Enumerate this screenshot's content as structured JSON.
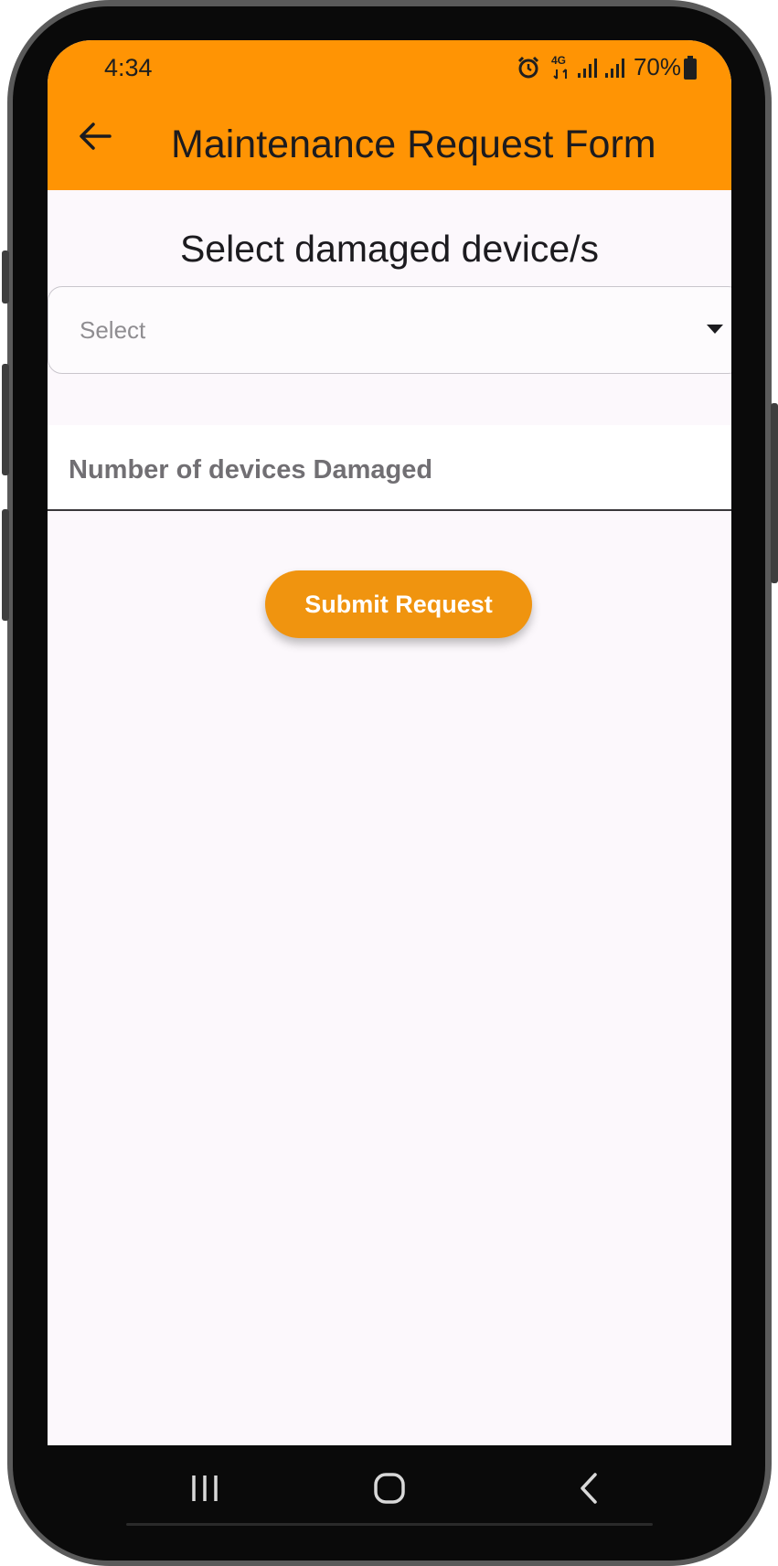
{
  "status_bar": {
    "time": "4:34",
    "network": "4G",
    "battery": "70%",
    "icons": [
      "alarm-icon",
      "network-4g-icon",
      "signal-icon",
      "signal-icon",
      "battery-icon"
    ]
  },
  "app_bar": {
    "back_icon": "arrow-left-icon",
    "title": "Maintenance Request Form"
  },
  "form": {
    "section_title": "Select damaged device/s",
    "device_select": {
      "placeholder": "Select",
      "arrow_icon": "triangle-down-icon"
    },
    "number_field": {
      "label": "Number of devices Damaged",
      "value": ""
    },
    "submit_label": "Submit Request"
  },
  "nav_bar": {
    "icons": [
      "recent-apps-icon",
      "home-icon",
      "back-icon"
    ]
  },
  "colors": {
    "app_bar": "#ff9404",
    "submit_button": "#f0940f",
    "background": "#fcf8fc"
  }
}
